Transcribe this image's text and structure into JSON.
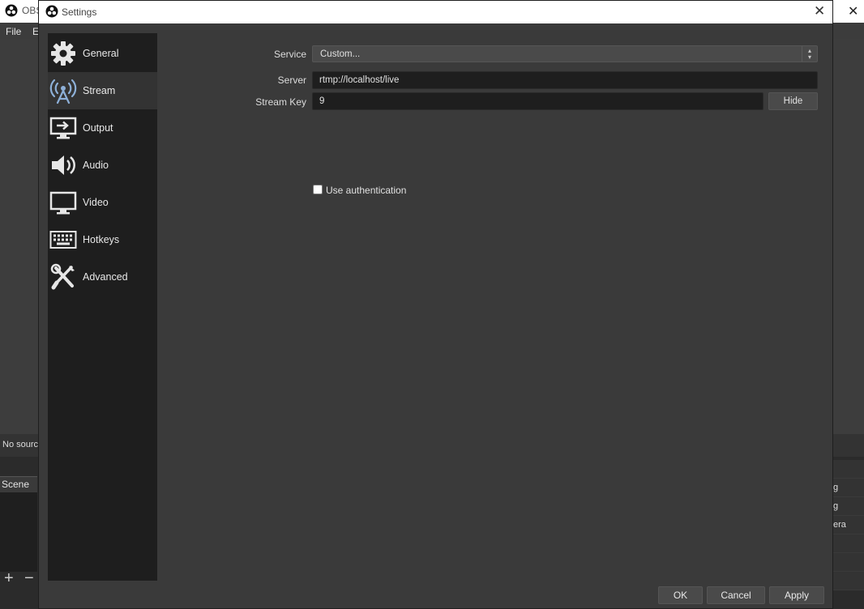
{
  "background": {
    "title": "OBS",
    "menu": {
      "file": "File",
      "edit": "E"
    },
    "status_text": "No sourc",
    "scene_header": "Scene",
    "right_rows": [
      "g",
      "g",
      "era",
      "",
      "",
      ""
    ]
  },
  "dialog": {
    "title": "Settings",
    "sidebar": [
      {
        "label": "General",
        "icon": "gear-icon"
      },
      {
        "label": "Stream",
        "icon": "antenna-icon",
        "active": true
      },
      {
        "label": "Output",
        "icon": "output-icon"
      },
      {
        "label": "Audio",
        "icon": "speaker-icon"
      },
      {
        "label": "Video",
        "icon": "monitor-icon"
      },
      {
        "label": "Hotkeys",
        "icon": "keyboard-icon"
      },
      {
        "label": "Advanced",
        "icon": "tools-icon"
      }
    ],
    "stream": {
      "service_label": "Service",
      "service_value": "Custom...",
      "server_label": "Server",
      "server_value": "rtmp://localhost/live",
      "stream_key_label": "Stream Key",
      "stream_key_value": "9",
      "hide_button": "Hide",
      "use_auth_label": "Use authentication",
      "use_auth_checked": false
    },
    "buttons": {
      "ok": "OK",
      "cancel": "Cancel",
      "apply": "Apply"
    }
  }
}
